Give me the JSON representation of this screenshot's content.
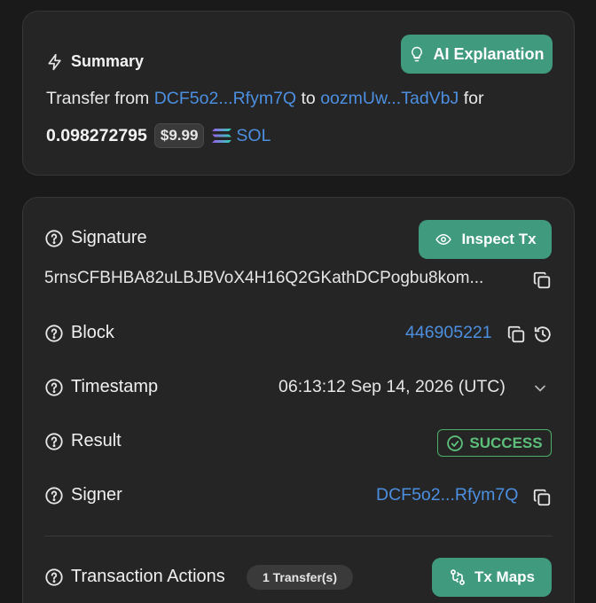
{
  "summary": {
    "title": "Summary",
    "ai_button_label": "AI Explanation",
    "transfer_prefix": "Transfer from",
    "from_address": "DCF5o2...Rfym7Q",
    "to_word": "to",
    "to_address": "oozmUw...TadVbJ",
    "for_word": "for",
    "amount": "0.098272795",
    "usd_value": "$9.99",
    "token": "SOL"
  },
  "details": {
    "signature": {
      "label": "Signature",
      "value": "5rnsCFBHBA82uLBJBVoX4H16Q2GKathDCPogbu8kom..."
    },
    "inspect_button_label": "Inspect Tx",
    "block": {
      "label": "Block",
      "value": "446905221"
    },
    "timestamp": {
      "label": "Timestamp",
      "value": "06:13:12 Sep 14, 2026 (UTC)"
    },
    "result": {
      "label": "Result",
      "value": "SUCCESS"
    },
    "signer": {
      "label": "Signer",
      "value": "DCF5o2...Rfym7Q"
    },
    "actions": {
      "label": "Transaction Actions",
      "count_badge": "1 Transfer(s)",
      "maps_button_label": "Tx Maps"
    }
  },
  "colors": {
    "background": "#1a1a1a",
    "card": "#252525",
    "accent_green": "#3f9a7e",
    "link_blue": "#4c8fe0",
    "success_green": "#5cc07a"
  },
  "icons": [
    "lightning-icon",
    "lightbulb-icon",
    "solana-logo",
    "help-circle-icon",
    "eye-icon",
    "copy-icon",
    "history-icon",
    "chevron-down-icon",
    "check-circle-icon",
    "route-icon"
  ]
}
